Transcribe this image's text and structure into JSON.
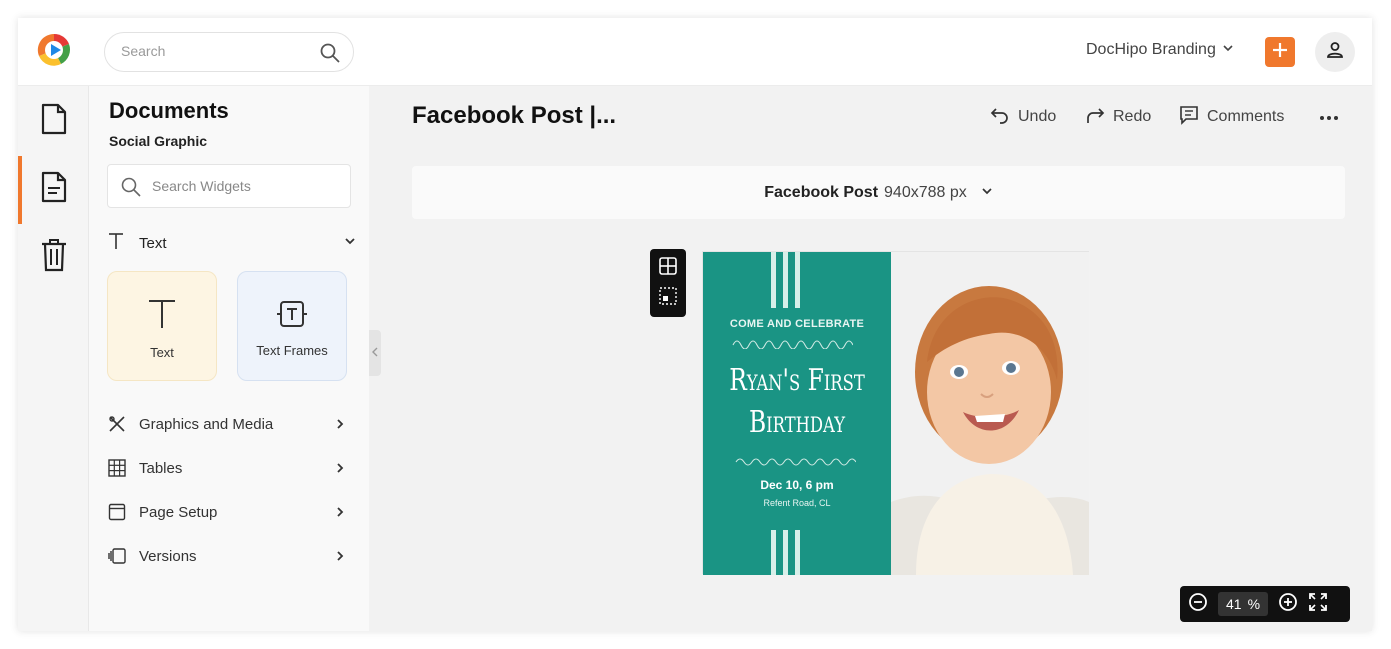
{
  "header": {
    "search_placeholder": "Search",
    "brand_label": "DocHipo Branding",
    "plus_icon": "plus-icon",
    "user_icon": "user-icon",
    "accent_color": "#f0782d"
  },
  "rail": {
    "items": [
      "document-icon",
      "page-icon",
      "trash-icon"
    ],
    "active_index": 1
  },
  "panel": {
    "title": "Documents",
    "subtitle": "Social Graphic",
    "widget_search_placeholder": "Search Widgets",
    "text_section": {
      "label": "Text",
      "cards": [
        {
          "label": "Text"
        },
        {
          "label": "Text Frames"
        }
      ]
    },
    "menu": [
      {
        "label": "Graphics and Media"
      },
      {
        "label": "Tables"
      },
      {
        "label": "Page Setup"
      },
      {
        "label": "Versions"
      }
    ]
  },
  "workspace": {
    "doc_title": "Facebook Post |...",
    "undo_label": "Undo",
    "redo_label": "Redo",
    "comments_label": "Comments",
    "size_name": "Facebook Post",
    "size_dims": "940x788 px"
  },
  "design": {
    "kicker": "COME AND CELEBRATE",
    "name_line1": "Ryan's First",
    "name_line2": "Birthday",
    "date": "Dec 10, 6 pm",
    "place": "Refent Road, CL",
    "panel_color": "#1a9484"
  },
  "zoom": {
    "value": "41",
    "unit": "%"
  }
}
